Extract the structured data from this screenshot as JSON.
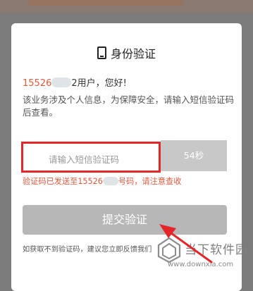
{
  "dialog": {
    "title": "身份验证",
    "greeting_num": "15526",
    "greeting_end": "2用户，您好!",
    "description": "该业务涉及个人信息，为保障安全，请输入短信验证码后查看。",
    "code_input": {
      "placeholder": "请输入短信验证码",
      "value": ""
    },
    "countdown": "54秒",
    "sent_prefix": "验证码已发送至15526",
    "sent_suffix": "号码，请注意查收",
    "submit_label": "提交验证",
    "help_text": "如获取不到验证码，建议您立即反馈我们"
  },
  "watermark": {
    "text": "当下软件园",
    "url": "www.downxia.com"
  },
  "colors": {
    "highlight": "#e3262a",
    "accent_text": "#e15a3e",
    "overlay": "#7b7b7b",
    "button_disabled": "#b7b7b7"
  },
  "icons": [
    "phone-icon",
    "red-arrow",
    "watermark-logo-icon"
  ]
}
